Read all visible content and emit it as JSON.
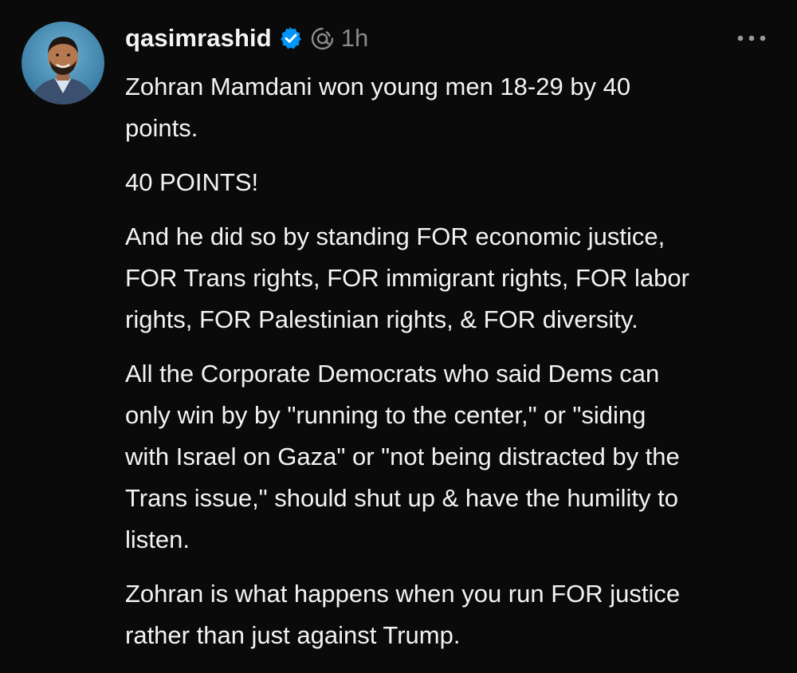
{
  "post": {
    "username": "qasimrashid",
    "timestamp": "1h",
    "icons": {
      "verified": "verified-badge-icon",
      "threads": "threads-logo-icon",
      "more": "more-options-icon"
    },
    "colors": {
      "background": "#0a0a0a",
      "text": "#f3f3f3",
      "muted": "#8b8b8b",
      "verified_badge": "#0095f6"
    },
    "paragraphs": [
      [
        "Zohran Mamdani won young men 18-29 by 40",
        "points."
      ],
      [
        "40 POINTS!"
      ],
      [
        "And he did so by standing FOR economic justice,",
        "FOR Trans rights, FOR immigrant rights, FOR labor",
        "rights, FOR Palestinian rights, & FOR diversity."
      ],
      [
        "All the Corporate Democrats who said Dems can",
        "only win by by \"running to the center,\" or \"siding",
        "with Israel on Gaza\" or \"not being distracted by the",
        "Trans issue,\" should shut up & have the humility to",
        "listen."
      ],
      [
        "Zohran is what happens when you run FOR justice",
        "rather than just against Trump."
      ]
    ]
  }
}
